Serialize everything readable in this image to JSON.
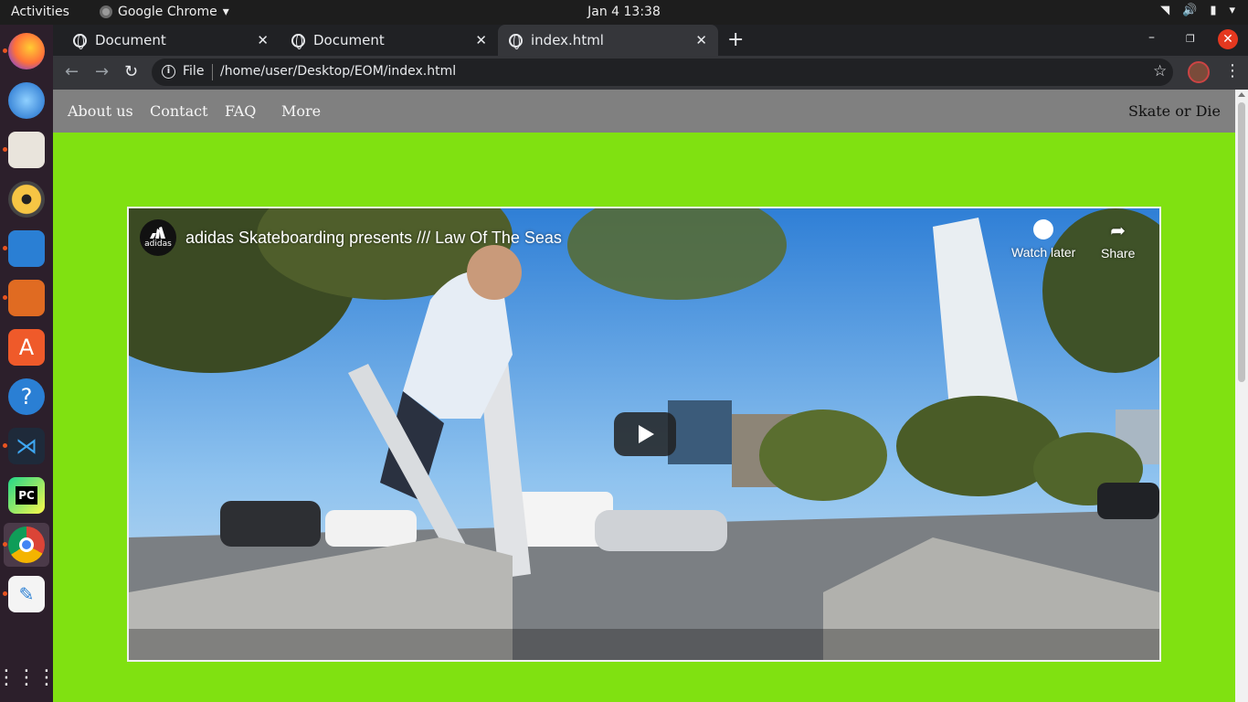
{
  "system": {
    "activities": "Activities",
    "app_name": "Google Chrome",
    "clock": "Jan 4  13:38"
  },
  "dock": {
    "apps": [
      "Firefox",
      "Thunderbird",
      "Files",
      "Rhythmbox",
      "LibreOffice Writer",
      "LibreOffice Impress",
      "Ubuntu Software",
      "Help",
      "Visual Studio Code",
      "PyCharm",
      "Google Chrome",
      "Text Editor",
      "Show Applications"
    ]
  },
  "browser": {
    "tabs": [
      {
        "title": "Document"
      },
      {
        "title": "Document"
      },
      {
        "title": "index.html"
      }
    ],
    "address": {
      "scheme_label": "File",
      "url": "/home/user/Desktop/EOM/index.html"
    }
  },
  "page": {
    "background": "#80e111",
    "nav": {
      "links": [
        "About us",
        "Contact",
        "FAQ",
        "More"
      ],
      "brand": "Skate or Die"
    },
    "video": {
      "channel_logo_text": "adidas",
      "title": "adidas Skateboarding presents /// Law Of The Seas",
      "watch_later": "Watch later",
      "share": "Share"
    }
  }
}
